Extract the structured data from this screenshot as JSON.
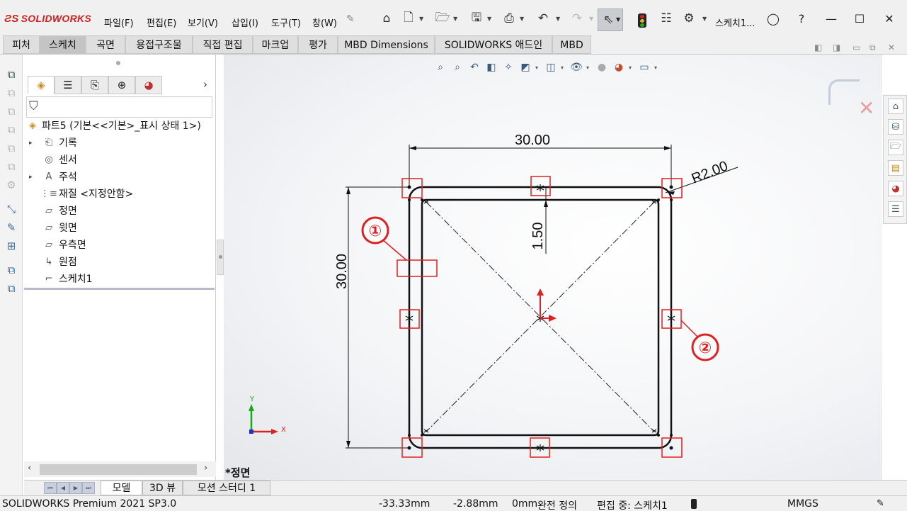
{
  "app": {
    "logo": "SOLIDWORKS",
    "doc_title": "스케치1..."
  },
  "menu": [
    "파일(F)",
    "편집(E)",
    "보기(V)",
    "삽입(I)",
    "도구(T)",
    "창(W)"
  ],
  "toolbar_icons": [
    "home-icon",
    "new-document-icon",
    "open-icon",
    "save-icon",
    "print-icon",
    "undo-icon",
    "redo-icon",
    "select-arrow-icon",
    "traffic-light-icon",
    "file-properties-icon",
    "options-gear-icon"
  ],
  "window_buttons": [
    "user-icon",
    "help-icon",
    "minimize-icon",
    "maximize-icon",
    "close-icon"
  ],
  "ribbon_tabs": [
    {
      "label": "피처"
    },
    {
      "label": "스케치",
      "active": true
    },
    {
      "label": "곡면"
    },
    {
      "label": "용접구조물"
    },
    {
      "label": "직접 편집"
    },
    {
      "label": "마크업"
    },
    {
      "label": "평가"
    },
    {
      "label": "MBD Dimensions"
    },
    {
      "label": "SOLIDWORKS 애드인"
    },
    {
      "label": "MBD"
    }
  ],
  "feature_tree": {
    "root": "파트5  (기본<<기본>_표시 상태 1>)",
    "items": [
      {
        "label": "기록",
        "icon": "history-icon",
        "expandable": true
      },
      {
        "label": "센서",
        "icon": "sensor-icon",
        "expandable": false
      },
      {
        "label": "주석",
        "icon": "annotation-icon",
        "expandable": true
      },
      {
        "label": "재질 <지정안함>",
        "icon": "material-icon",
        "expandable": false
      },
      {
        "label": "정면",
        "icon": "plane-icon",
        "expandable": false
      },
      {
        "label": "윗면",
        "icon": "plane-icon",
        "expandable": false
      },
      {
        "label": "우측면",
        "icon": "plane-icon",
        "expandable": false
      },
      {
        "label": "원점",
        "icon": "origin-icon",
        "expandable": false
      },
      {
        "label": "스케치1",
        "icon": "sketch-icon",
        "expandable": false
      }
    ]
  },
  "bottom_tabs": [
    {
      "label": "모델",
      "active": true
    },
    {
      "label": "3D 뷰"
    },
    {
      "label": "모션 스터디 1"
    }
  ],
  "graphics": {
    "view_label": "*정면",
    "dimensions": {
      "width": "30.00",
      "height": "30.00",
      "offset": "1.50",
      "radius": "R2.00"
    },
    "callouts": [
      "①",
      "②"
    ],
    "axes": {
      "x": "X",
      "y": "Y"
    }
  },
  "status": {
    "product": "SOLIDWORKS Premium 2021 SP3.0",
    "x": "-33.33mm",
    "y": "-2.88mm",
    "z": "0mm",
    "definition": "완전 정의",
    "editing": "편집 중: 스케치1",
    "units": "MMGS"
  },
  "colors": {
    "brand": "#d02020",
    "highlight_box": "#e02020",
    "axis_red": "#e02020",
    "axis_green": "#18a818",
    "axis_blue": "#2030c0"
  }
}
